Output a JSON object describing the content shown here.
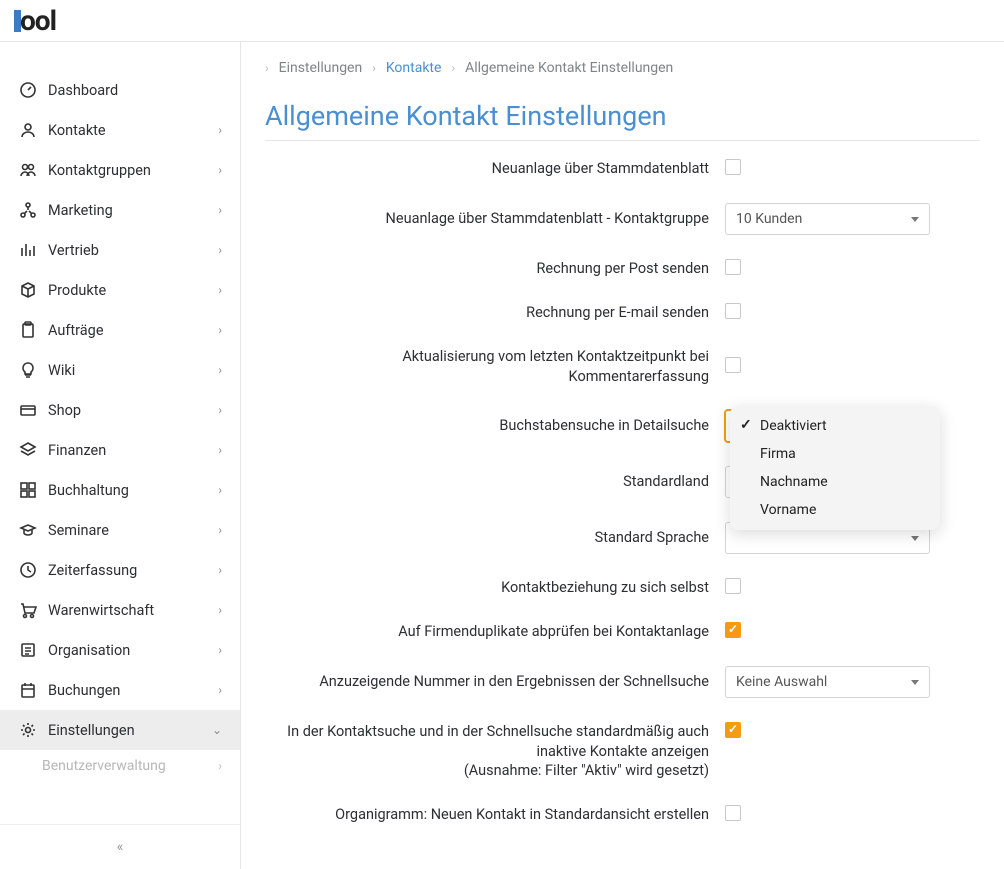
{
  "logo_text": "ool",
  "sidebar": {
    "items": [
      {
        "label": "Dashboard",
        "icon": "gauge",
        "caret": false
      },
      {
        "label": "Kontakte",
        "icon": "user",
        "caret": true
      },
      {
        "label": "Kontaktgruppen",
        "icon": "users",
        "caret": true
      },
      {
        "label": "Marketing",
        "icon": "network",
        "caret": true
      },
      {
        "label": "Vertrieb",
        "icon": "bars",
        "caret": true
      },
      {
        "label": "Produkte",
        "icon": "cube",
        "caret": true
      },
      {
        "label": "Aufträge",
        "icon": "clipboard",
        "caret": true
      },
      {
        "label": "Wiki",
        "icon": "bulb",
        "caret": true
      },
      {
        "label": "Shop",
        "icon": "card",
        "caret": true
      },
      {
        "label": "Finanzen",
        "icon": "layers",
        "caret": true
      },
      {
        "label": "Buchhaltung",
        "icon": "grid",
        "caret": true
      },
      {
        "label": "Seminare",
        "icon": "cap",
        "caret": true
      },
      {
        "label": "Zeiterfassung",
        "icon": "clock",
        "caret": true
      },
      {
        "label": "Warenwirtschaft",
        "icon": "cart",
        "caret": true
      },
      {
        "label": "Organisation",
        "icon": "list",
        "caret": true
      },
      {
        "label": "Buchungen",
        "icon": "calendar",
        "caret": true
      },
      {
        "label": "Einstellungen",
        "icon": "gear",
        "caret": true,
        "active": true
      }
    ],
    "sub_item": "Benutzerverwaltung"
  },
  "breadcrumb": {
    "a": "Einstellungen",
    "b": "Kontakte",
    "c": "Allgemeine Kontakt Einstellungen"
  },
  "page_title": "Allgemeine Kontakt Einstellungen",
  "form": {
    "f1": "Neuanlage über Stammdatenblatt",
    "f2": "Neuanlage über Stammdatenblatt - Kontaktgruppe",
    "f2_val": "10 Kunden",
    "f3": "Rechnung per Post senden",
    "f4": "Rechnung per E-mail senden",
    "f5": "Aktualisierung vom letzten Kontaktzeitpunkt bei Kommentarerfassung",
    "f6": "Buchstabensuche in Detailsuche",
    "f7": "Standardland",
    "f8": "Standard Sprache",
    "f9": "Kontaktbeziehung zu sich selbst",
    "f10": "Auf Firmenduplikate abprüfen bei Kontaktanlage",
    "f11": "Anzuzeigende Nummer in den Ergebnissen der Schnellsuche",
    "f11_val": "Keine Auswahl",
    "f12": "In der Kontaktsuche und in der Schnellsuche standardmäßig auch inaktive Kontakte anzeigen\n(Ausnahme: Filter \"Aktiv\" wird gesetzt)",
    "f13": "Organigramm: Neuen Kontakt in Standardansicht erstellen"
  },
  "dropdown": {
    "o1": "Deaktiviert",
    "o2": "Firma",
    "o3": "Nachname",
    "o4": "Vorname"
  }
}
